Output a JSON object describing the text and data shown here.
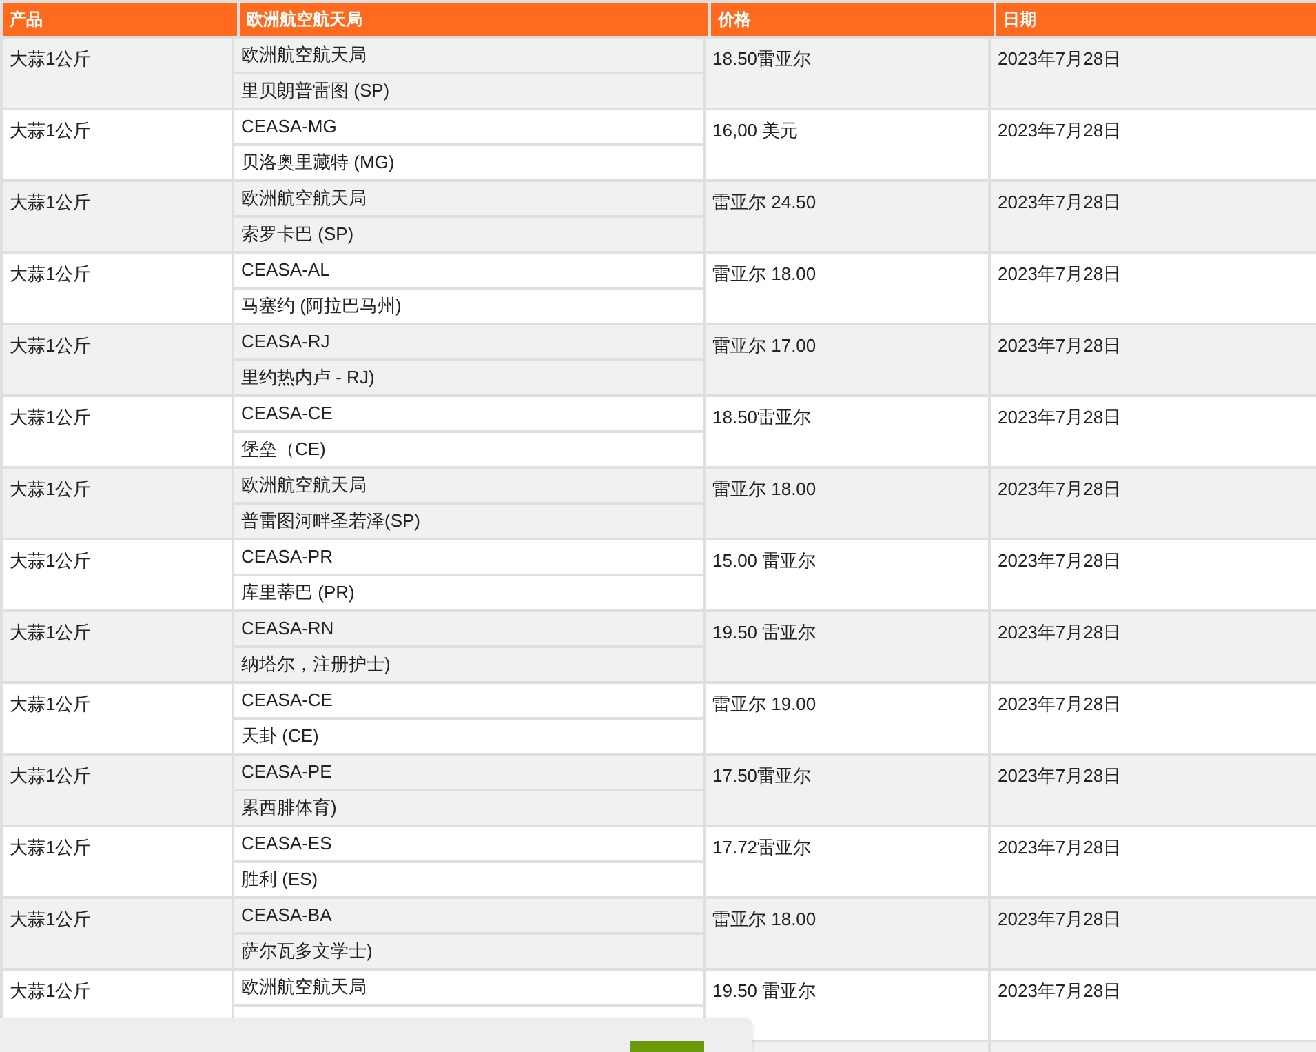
{
  "table": {
    "columns": [
      "产品",
      "欧洲航空航天局",
      "价格",
      "日期"
    ],
    "rows": [
      {
        "product": "大蒜1公斤",
        "market": [
          "欧洲航空航天局",
          "里贝朗普雷图 (SP)"
        ],
        "price": "18.50雷亚尔",
        "date": "2023年7月28日"
      },
      {
        "product": "大蒜1公斤",
        "market": [
          "CEASA-MG",
          "贝洛奥里藏特 (MG)"
        ],
        "price": "16,00 美元",
        "date": "2023年7月28日"
      },
      {
        "product": "大蒜1公斤",
        "market": [
          "欧洲航空航天局",
          "索罗卡巴 (SP)"
        ],
        "price": "雷亚尔 24.50",
        "date": "2023年7月28日"
      },
      {
        "product": "大蒜1公斤",
        "market": [
          "CEASA-AL",
          "马塞约 (阿拉巴马州)"
        ],
        "price": "雷亚尔 18.00",
        "date": "2023年7月28日"
      },
      {
        "product": "大蒜1公斤",
        "market": [
          "CEASA-RJ",
          "里约热内卢 - RJ)"
        ],
        "price": "雷亚尔 17.00",
        "date": "2023年7月28日"
      },
      {
        "product": "大蒜1公斤",
        "market": [
          "CEASA-CE",
          "堡垒（CE)"
        ],
        "price": "18.50雷亚尔",
        "date": "2023年7月28日"
      },
      {
        "product": "大蒜1公斤",
        "market": [
          "欧洲航空航天局",
          "普雷图河畔圣若泽(SP)"
        ],
        "price": "雷亚尔 18.00",
        "date": "2023年7月28日"
      },
      {
        "product": "大蒜1公斤",
        "market": [
          "CEASA-PR",
          "库里蒂巴 (PR)"
        ],
        "price": "15.00 雷亚尔",
        "date": "2023年7月28日"
      },
      {
        "product": "大蒜1公斤",
        "market": [
          "CEASA-RN",
          "纳塔尔，注册护士)"
        ],
        "price": "19.50 雷亚尔",
        "date": "2023年7月28日"
      },
      {
        "product": "大蒜1公斤",
        "market": [
          "CEASA-CE",
          "天卦 (CE)"
        ],
        "price": "雷亚尔 19.00",
        "date": "2023年7月28日"
      },
      {
        "product": "大蒜1公斤",
        "market": [
          "CEASA-PE",
          "累西腓体育)"
        ],
        "price": "17.50雷亚尔",
        "date": "2023年7月28日"
      },
      {
        "product": "大蒜1公斤",
        "market": [
          "CEASA-ES",
          "胜利 (ES)"
        ],
        "price": "17.72雷亚尔",
        "date": "2023年7月28日"
      },
      {
        "product": "大蒜1公斤",
        "market": [
          "CEASA-BA",
          "萨尔瓦多文学士)"
        ],
        "price": "雷亚尔 18.00",
        "date": "2023年7月28日"
      },
      {
        "product": "大蒜1公斤",
        "market": [
          "欧洲航空航天局"
        ],
        "price": "19.50 雷亚尔",
        "date": "2023年7月28日"
      }
    ]
  }
}
